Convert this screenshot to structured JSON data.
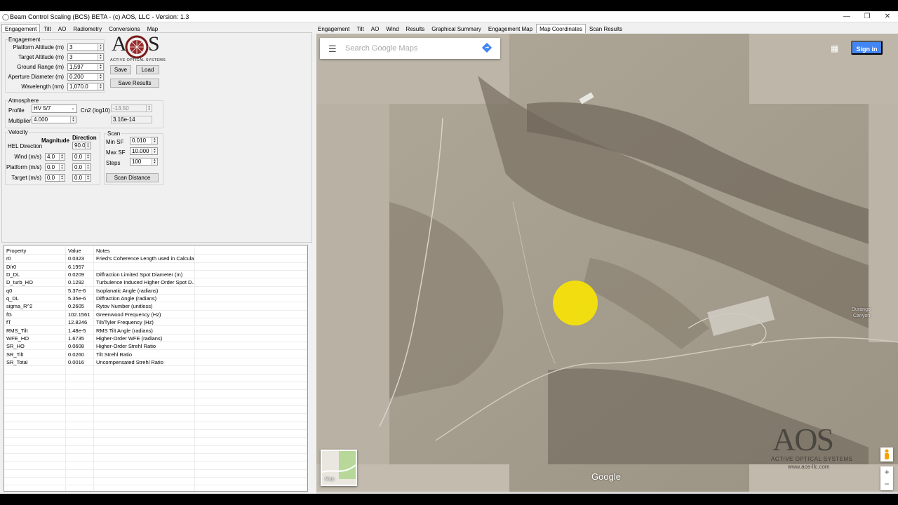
{
  "window": {
    "title": "Beam Control Scaling (BCS) BETA - (c) AOS, LLC - Version: 1.3",
    "minimize_glyph": "—",
    "maximize_glyph": "❐",
    "close_glyph": "✕"
  },
  "left_tabs": [
    "Engagement",
    "Tilt",
    "AO",
    "Radiometry",
    "Conversions",
    "Map"
  ],
  "right_tabs": [
    "Engagement",
    "Tilt",
    "AO",
    "Wind",
    "Results",
    "Graphical Summary",
    "Engagement Map",
    "Map Coordinates",
    "Scan Results"
  ],
  "engagement": {
    "group_label": "Engagement",
    "fields": [
      {
        "label": "Platform Altitude (m)",
        "value": "3"
      },
      {
        "label": "Target Altitude (m)",
        "value": "3"
      },
      {
        "label": "Ground Range (m)",
        "value": "1,597"
      },
      {
        "label": "Aperture Diameter (m)",
        "value": "0.200"
      },
      {
        "label": "Wavelength (nm)",
        "value": "1,070.0"
      }
    ],
    "save_label": "Save",
    "load_label": "Load",
    "save_results_label": "Save Results"
  },
  "logo": {
    "text": "AOS",
    "subtext": "ACTIVE OPTICAL SYSTEMS"
  },
  "atmosphere": {
    "group_label": "Atmosphere",
    "profile_label": "Profile",
    "profile_value": "HV 5/7",
    "cn2_label": "Cn2 (log10)",
    "cn2_value": "-13.50",
    "multiplier_label": "Multiplier",
    "multiplier_value": "4.000",
    "cn2_readout": "3.16e-14"
  },
  "velocity": {
    "group_label": "Velocity",
    "magnitude_header": "Magnitude",
    "direction_header": "Direction",
    "hel_label": "HEL Direction",
    "hel_direction": "90.0",
    "rows": [
      {
        "label": "Wind (m/s)",
        "magnitude": "4.0",
        "direction": "0.0"
      },
      {
        "label": "Platform (m/s)",
        "magnitude": "0.0",
        "direction": "0.0"
      },
      {
        "label": "Target (m/s)",
        "magnitude": "0.0",
        "direction": "0.0"
      }
    ]
  },
  "scan": {
    "group_label": "Scan",
    "min_sf_label": "Min SF",
    "min_sf_value": "0.010",
    "max_sf_label": "Max SF",
    "max_sf_value": "10.000",
    "steps_label": "Steps",
    "steps_value": "100",
    "scan_distance_label": "Scan Distance"
  },
  "results_table": {
    "headers": [
      "Property",
      "Value",
      "Notes"
    ],
    "rows": [
      [
        "r0",
        "0.0323",
        "Fried's Coherence Length used in Calcula..."
      ],
      [
        "D/r0",
        "6.1957",
        ""
      ],
      [
        "D_DL",
        "0.0209",
        "Diffraction Limited Spot Diameter (m)"
      ],
      [
        "D_turb_HO",
        "0.1292",
        "Turbulence Induced Higher Order Spot D..."
      ],
      [
        "q0",
        "5.37e-6",
        "Isoplanatic Angle (radians)"
      ],
      [
        "q_DL",
        "5.35e-6",
        "Diffraction Angle (radians)"
      ],
      [
        "sigma_R^2",
        "0.2605",
        "Rytov Number (unitless)"
      ],
      [
        "fG",
        "102.1561",
        "Greenwood Frequency (Hz)"
      ],
      [
        "fT",
        "12.8246",
        "Tilt/Tyler Frequency (Hz)"
      ],
      [
        "RMS_Tilt",
        "1.48e-5",
        "RMS Tilt Angle (radians)"
      ],
      [
        "WFE_HO",
        "1.6735",
        "Higher-Order WFE (radians)"
      ],
      [
        "SR_HO",
        "0.0608",
        "Higher-Order Strehl Ratio"
      ],
      [
        "SR_Tilt",
        "0.0260",
        "Tilt Strehl Ratio"
      ],
      [
        "SR_Total",
        "0.0016",
        "Uncompensated Strehl Ratio"
      ]
    ]
  },
  "map": {
    "search_placeholder": "Search Google Maps",
    "sign_in_label": "Sign in",
    "map_type_label": "Map",
    "google_label": "Google",
    "zoom_in": "+",
    "zoom_out": "−",
    "watermark_logo": "AOS",
    "watermark_sub": "ACTIVE OPTICAL SYSTEMS",
    "watermark_url": "www.aos-llc.com",
    "place_labels": [
      "Durango",
      "Canyon"
    ],
    "marker_color": "#f5e10a"
  }
}
